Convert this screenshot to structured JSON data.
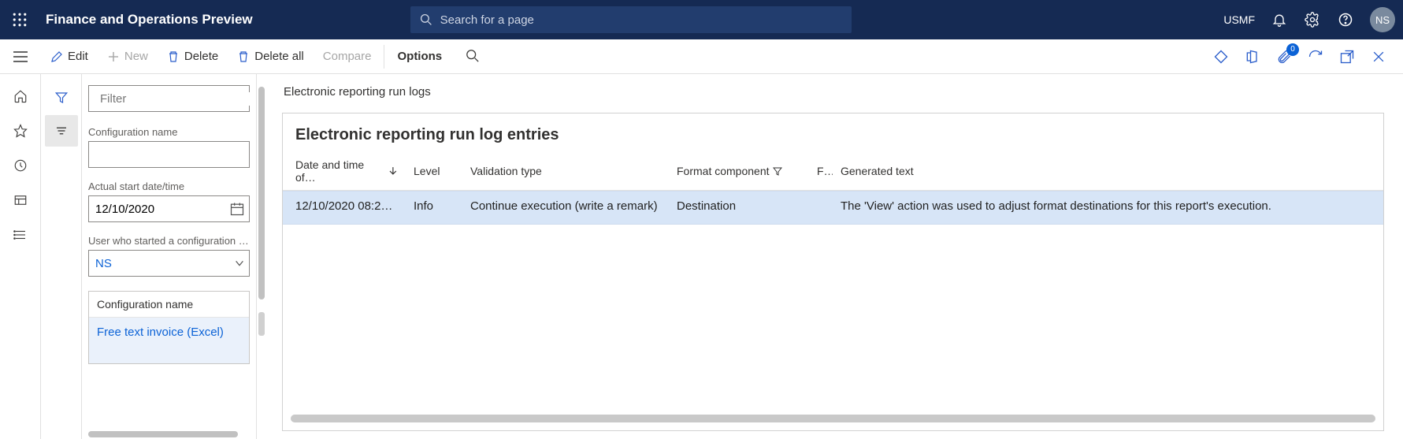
{
  "header": {
    "app_title": "Finance and Operations Preview",
    "search_placeholder": "Search for a page",
    "legal_entity": "USMF",
    "avatar_initials": "NS",
    "attachment_badge": "0"
  },
  "actionbar": {
    "edit": "Edit",
    "new": "New",
    "delete": "Delete",
    "delete_all": "Delete all",
    "compare": "Compare",
    "options": "Options"
  },
  "filterpanel": {
    "filter_placeholder": "Filter",
    "config_name_label": "Configuration name",
    "config_name_value": "",
    "actual_start_label": "Actual start date/time",
    "actual_start_value": "12/10/2020",
    "user_label": "User who started a configuration run",
    "user_value": "NS",
    "config_list_header": "Configuration name",
    "config_list_item": "Free text invoice (Excel)"
  },
  "main": {
    "breadcrumb": "Electronic reporting run logs",
    "card_title": "Electronic reporting run log entries",
    "columns": {
      "c1": "Date and time of…",
      "c2": "Level",
      "c3": "Validation type",
      "c4": "Format component",
      "c5": "F…",
      "c6": "Generated text"
    },
    "row": {
      "datetime": "12/10/2020 08:2…",
      "level": "Info",
      "validation": "Continue execution (write a remark)",
      "component": "Destination",
      "f": "",
      "text": "The 'View' action was used to adjust format destinations for this report's execution."
    }
  }
}
